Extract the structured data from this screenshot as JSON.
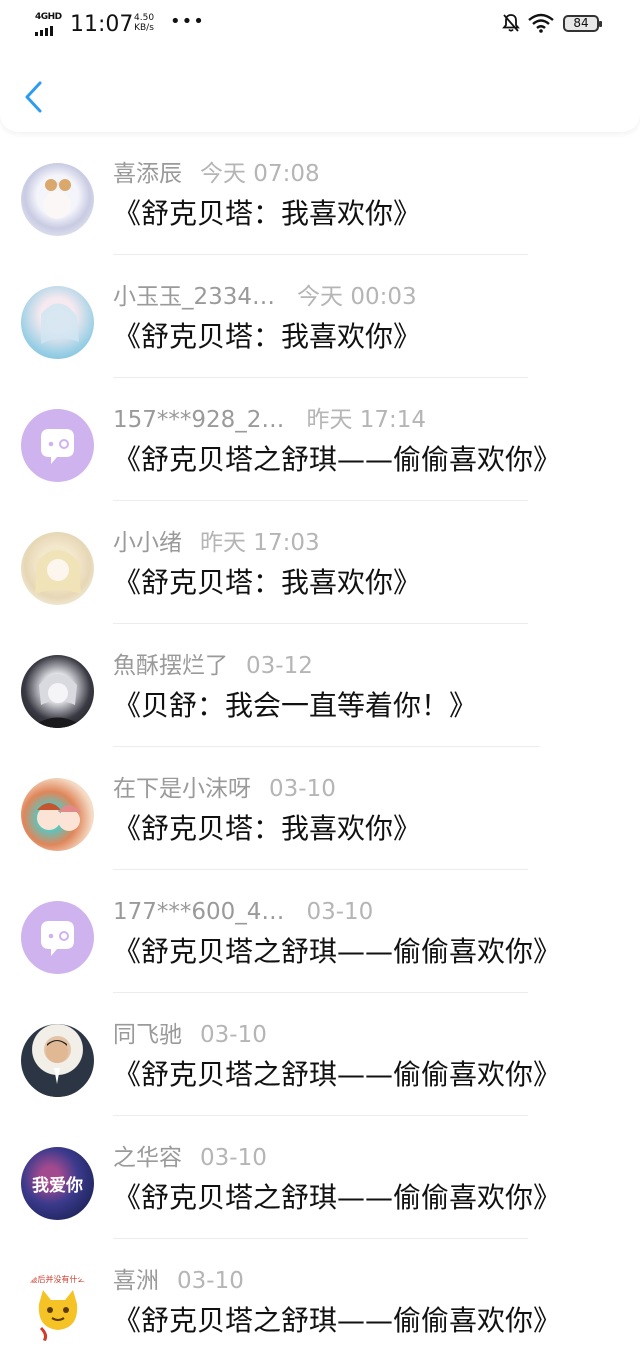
{
  "status_bar": {
    "network": "4GHD",
    "time": "11:07",
    "speed_value": "4.50",
    "speed_unit": "KB/s",
    "more": "•••",
    "battery": "84"
  },
  "colors": {
    "accent": "#2d9cf0",
    "name_text": "#9a9a9a",
    "time_text": "#b5b5b5",
    "message_text": "#111111",
    "default_avatar": "#cfb3ef"
  },
  "items": [
    {
      "name": "喜添辰",
      "time": "今天 07:08",
      "message": "《舒克贝塔：我喜欢你》",
      "avatar": "anime-avatar"
    },
    {
      "name": "小玉玉_2334…",
      "time": "今天 00:03",
      "message": "《舒克贝塔：我喜欢你》",
      "avatar": "anime-avatar"
    },
    {
      "name": "157***928_2…",
      "time": "昨天 17:14",
      "message": "《舒克贝塔之舒琪——偷偷喜欢你》",
      "avatar": "default-chat-avatar"
    },
    {
      "name": "小小绪",
      "time": "昨天 17:03",
      "message": "《舒克贝塔：我喜欢你》",
      "avatar": "anime-avatar"
    },
    {
      "name": "魚酥摆烂了",
      "time": "03-12",
      "message": "《贝舒：我会一直等着你！》",
      "avatar": "anime-avatar"
    },
    {
      "name": "在下是小沫呀",
      "time": "03-10",
      "message": "《舒克贝塔：我喜欢你》",
      "avatar": "anime-avatar"
    },
    {
      "name": "177***600_4…",
      "time": "03-10",
      "message": "《舒克贝塔之舒琪——偷偷喜欢你》",
      "avatar": "default-chat-avatar"
    },
    {
      "name": "同飞驰",
      "time": "03-10",
      "message": "《舒克贝塔之舒琪——偷偷喜欢你》",
      "avatar": "photo-avatar"
    },
    {
      "name": "之华容",
      "time": "03-10",
      "message": "《舒克贝塔之舒琪——偷偷喜欢你》",
      "avatar": "galaxy-avatar",
      "avatar_text": "我爱你"
    },
    {
      "name": "喜洲",
      "time": "03-10",
      "message": "《舒克贝塔之舒琪——偷偷喜欢你》",
      "avatar": "sticker-avatar",
      "avatar_text": "最后并没有什么"
    }
  ]
}
